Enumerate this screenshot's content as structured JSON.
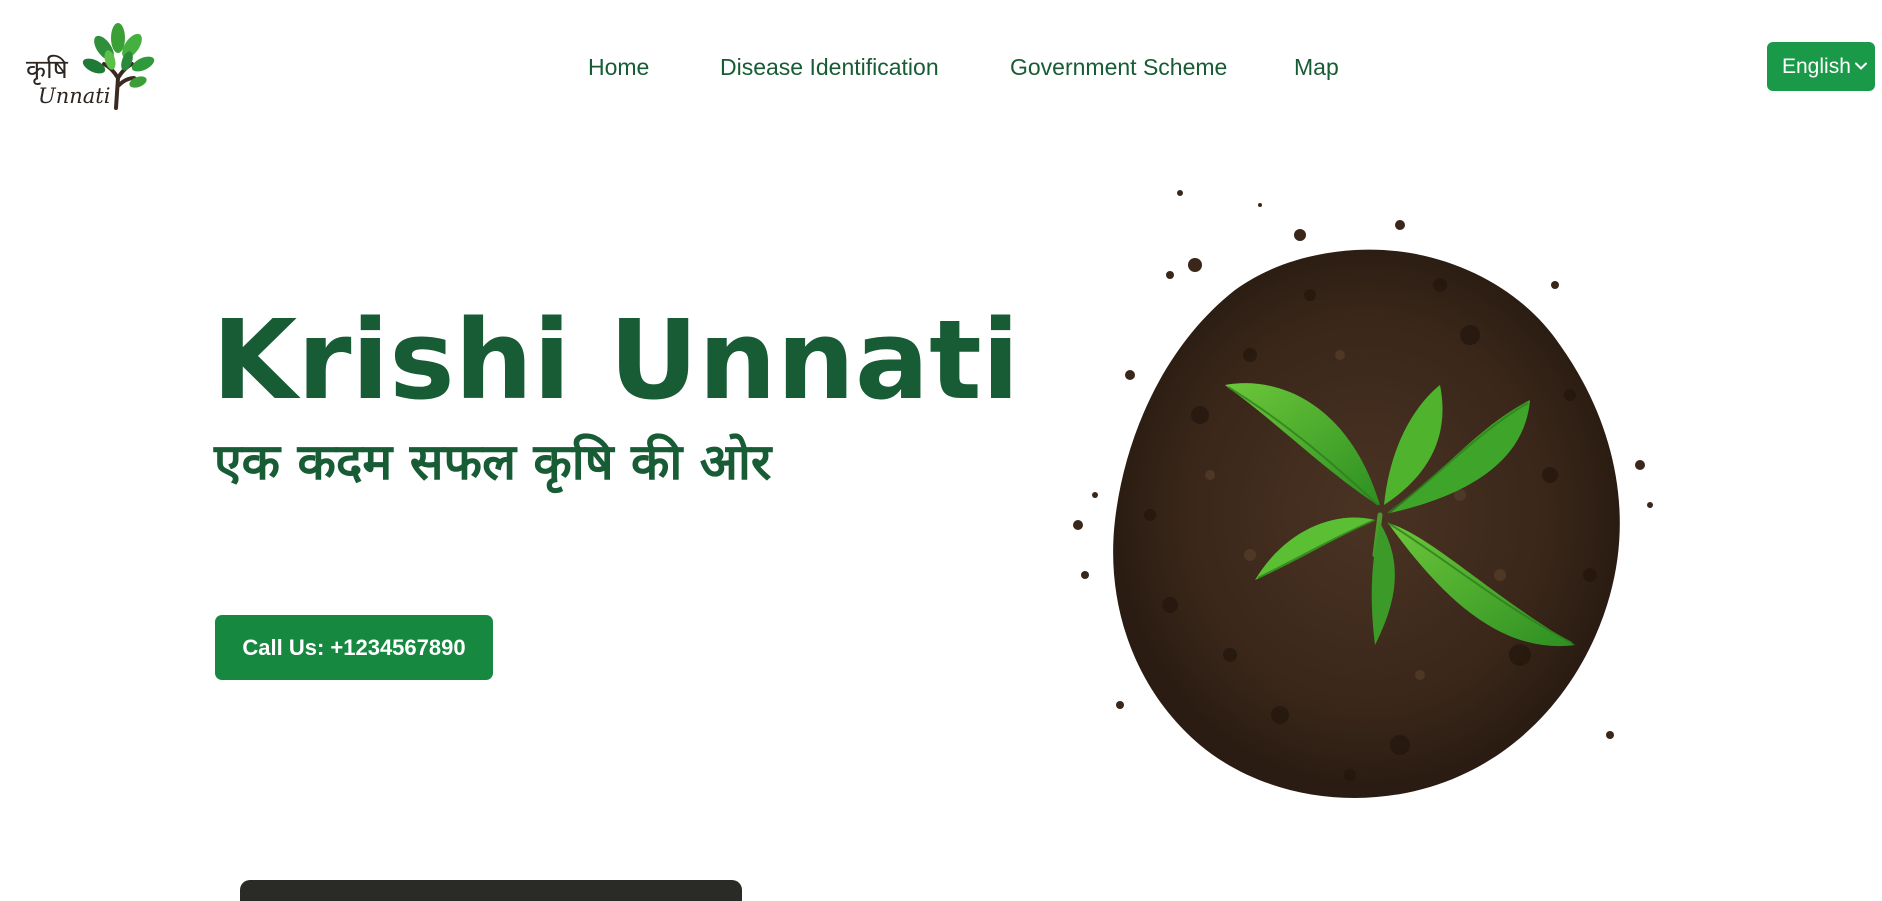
{
  "logo": {
    "script_text": "कृषि",
    "wordmark": "Unnati",
    "icon": "tree-logo-icon"
  },
  "nav": {
    "items": [
      {
        "label": "Home"
      },
      {
        "label": "Disease Identification"
      },
      {
        "label": "Government Scheme"
      },
      {
        "label": "Map"
      }
    ]
  },
  "language": {
    "selected": "English",
    "icon": "chevron-down-icon"
  },
  "hero": {
    "title": "Krishi Unnati",
    "tagline": "एक कदम सफल कृषि की ओर",
    "call_button": "Call Us: +1234567890",
    "image_icon": "plant-in-soil-illustration"
  },
  "colors": {
    "brand_dark_green": "#175c34",
    "button_green": "#178840",
    "language_green": "#1a9a48",
    "soil_brown": "#3f2a1c",
    "leaf_green": "#3fae2a"
  }
}
